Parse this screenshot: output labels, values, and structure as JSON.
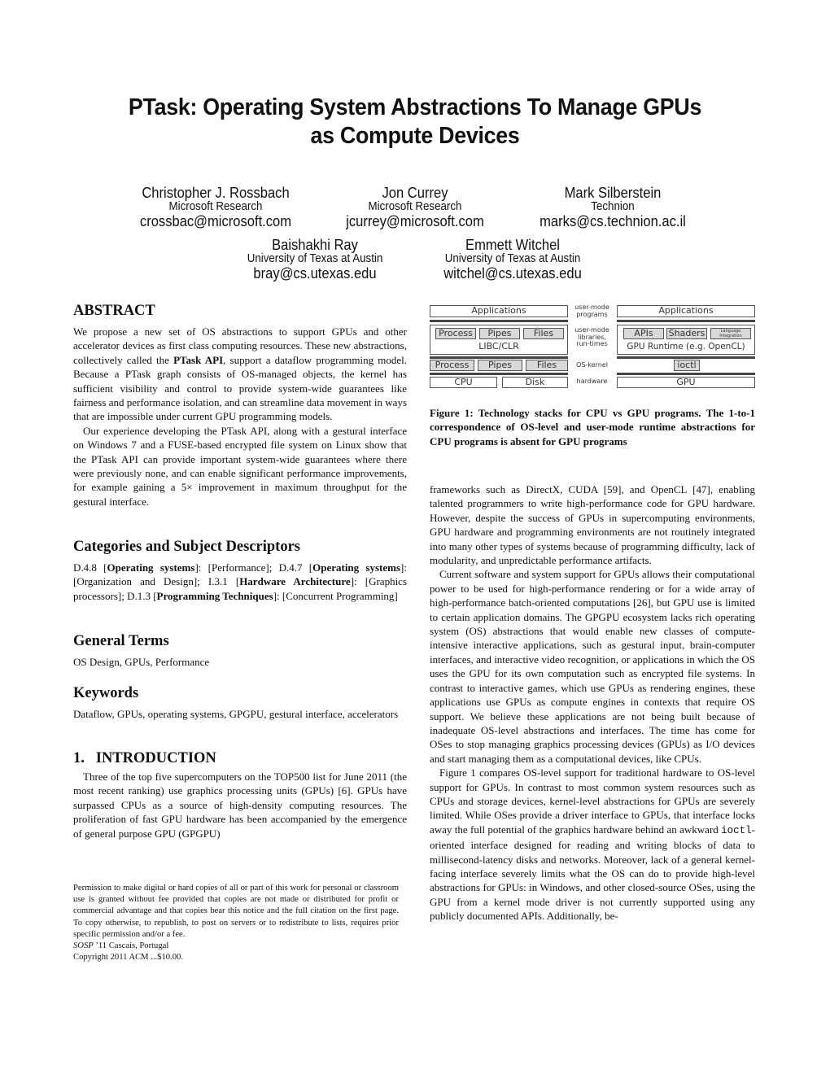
{
  "paper": {
    "title_line1": "PTask: Operating System Abstractions To Manage GPUs",
    "title_line2": "as Compute Devices",
    "authors": [
      {
        "name": "Christopher J. Rossbach",
        "affiliation": "Microsoft Research",
        "email": "crossbac@microsoft.com"
      },
      {
        "name": "Jon Currey",
        "affiliation": "Microsoft Research",
        "email": "jcurrey@microsoft.com"
      },
      {
        "name": "Mark Silberstein",
        "affiliation": "Technion",
        "email": "marks@cs.technion.ac.il"
      },
      {
        "name": "Baishakhi Ray",
        "affiliation": "University of Texas at Austin",
        "email": "bray@cs.utexas.edu"
      },
      {
        "name": "Emmett Witchel",
        "affiliation": "University of Texas at Austin",
        "email": "witchel@cs.utexas.edu"
      }
    ]
  },
  "abstract": {
    "heading": "ABSTRACT",
    "p1_a": "We propose a new set of OS abstractions to support GPUs and other accelerator devices as first class computing resources.  These new abstractions, collectively called the ",
    "p1_bold": "PTask API",
    "p1_b": ", support a dataflow programming model. Because a PTask graph consists of OS-managed objects, the kernel has sufficient visibility and control to provide system-wide guarantees like fairness and performance isolation, and can streamline data movement in ways that are impossible under current GPU programming models.",
    "p2": "Our experience developing the PTask API, along with a gestural interface on Windows 7 and a FUSE-based encrypted file system on Linux show that the PTask API can provide important system-wide guarantees where there were previously none, and can enable significant performance improvements, for example gaining a 5× improvement in maximum throughput for the gestural interface."
  },
  "categories": {
    "heading": "Categories and Subject Descriptors",
    "parts": [
      {
        "t": "D.4.8 [",
        "b": false
      },
      {
        "t": "Operating systems",
        "b": true
      },
      {
        "t": "]: [Performance]; D.4.7 [",
        "b": false
      },
      {
        "t": "Operating systems",
        "b": true
      },
      {
        "t": "]: [Organization and Design]; I.3.1 [",
        "b": false
      },
      {
        "t": "Hardware Architecture",
        "b": true
      },
      {
        "t": "]: [Graphics processors]; D.1.3 [",
        "b": false
      },
      {
        "t": "Programming Techniques",
        "b": true
      },
      {
        "t": "]: [Concurrent Programming]",
        "b": false
      }
    ]
  },
  "general_terms": {
    "heading": "General Terms",
    "text": "OS Design, GPUs, Performance"
  },
  "keywords": {
    "heading": "Keywords",
    "text": "Dataflow, GPUs, operating systems, GPGPU, gestural interface, accelerators"
  },
  "introduction": {
    "heading": "1.   INTRODUCTION",
    "left_text": "Three of the top five supercomputers on the TOP500 list for June 2011 (the most recent ranking) use graphics processing units (GPUs) [6]. GPUs have surpassed CPUs as a source of high-density computing resources.  The proliferation of fast GPU hardware has been accompanied by the emergence of general purpose GPU (GPGPU)",
    "right_p1": "frameworks such as DirectX, CUDA [59], and OpenCL [47], enabling talented programmers to write high-performance code for GPU hardware.  However, despite the success of GPUs in supercomputing environments, GPU hardware and programming environments are not routinely integrated into many other types of systems because of programming difficulty, lack of modularity, and unpredictable performance artifacts.",
    "right_p2": "Current software and system support for GPUs allows their computational power to be used for high-performance rendering or for a wide array of high-performance batch-oriented computations [26], but GPU use is limited to certain application domains. The GPGPU ecosystem lacks rich operating system (OS) abstractions that would enable new classes of compute-intensive interactive applications, such as gestural input, brain-computer interfaces, and interactive video recognition, or applications in which the OS uses the GPU for its own computation such as encrypted file systems. In contrast to interactive games, which use GPUs as rendering engines, these applications use GPUs as compute engines in contexts that require OS support.  We believe these applications are not being built because of inadequate OS-level abstractions and interfaces. The time has come for OSes to stop managing graphics processing devices (GPUs) as I/O devices and start managing them as a computational devices, like CPUs.",
    "right_p3_a": "Figure 1 compares OS-level support for traditional hardware to OS-level support for GPUs.  In contrast to most common system resources such as CPUs and storage devices, kernel-level abstractions for GPUs are severely limited.  While OSes provide a driver interface to GPUs, that interface locks away the full potential of the graphics hardware behind an awkward ",
    "right_p3_code": "ioctl",
    "right_p3_b": "-oriented interface designed for reading and writing blocks of data to millisecond-latency disks and networks.  Moreover, lack of a general kernel-facing interface severely limits what the OS can do to provide high-level abstractions for GPUs: in Windows, and other closed-source OSes, using the GPU from a kernel mode driver is not currently supported using any publicly documented APIs.  Additionally, be-"
  },
  "footnote": {
    "permission": "Permission to make digital or hard copies of all or part of this work for personal or classroom use is granted without fee provided that copies are not made or distributed for profit or commercial advantage and that copies bear this notice and the full citation on the first page. To copy otherwise, to republish, to post on servers or to redistribute to lists, requires prior specific permission and/or a fee.",
    "venue_italic": "SOSP",
    "venue_rest": " ’11 Cascais, Portugal",
    "copyright": "Copyright 2011 ACM  ...$10.00."
  },
  "figure1": {
    "cpu_stack": {
      "applications": "Applications",
      "lib_items": [
        "Process",
        "Pipes",
        "Files"
      ],
      "lib_name": "LIBC/CLR",
      "kernel_items": [
        "Process",
        "Pipes",
        "Files"
      ],
      "hardware": [
        "CPU",
        "Disk"
      ]
    },
    "layer_labels": {
      "programs": [
        "user-mode",
        "programs"
      ],
      "libraries": [
        "user-mode",
        "libraries,",
        "run-times"
      ],
      "kernel": "OS-kernel",
      "hardware": "hardware"
    },
    "gpu_stack": {
      "applications": "Applications",
      "runtime_items": [
        "APIs",
        "Shaders",
        "Language Integration"
      ],
      "runtime_name": "GPU Runtime (e.g. OpenCL)",
      "kernel_items": [
        "ioctl"
      ],
      "hardware": "GPU"
    },
    "caption": "Figure 1: Technology stacks for CPU vs GPU programs.  The 1-to-1 correspondence of OS-level and user-mode runtime abstractions for CPU programs is absent for GPU programs"
  }
}
